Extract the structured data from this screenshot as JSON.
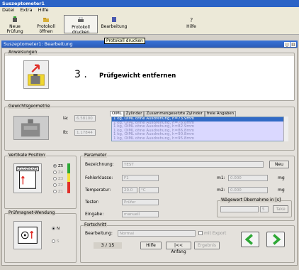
{
  "window": {
    "title": "Suszeptometer1"
  },
  "menu": {
    "items": [
      "Datei",
      "Extra",
      "Hilfe"
    ]
  },
  "toolbar": {
    "items": [
      "Neue Prüfung",
      "Protokoll öffnen",
      "Protokoll drucken",
      "Bearbeitung",
      "Hilfe"
    ],
    "tooltip": "Protokoll drucken"
  },
  "subwindow": {
    "title": "Suszeptometer1: Bearbeitung"
  },
  "instructions": {
    "legend": "Anweisungen",
    "step": "3 .",
    "text": "Prüfgewicht entfernen"
  },
  "geometry": {
    "legend": "Gewichtsgeometrie",
    "ia_label": "Ia:",
    "ia_value": "6.58100",
    "ib_label": "Ib:",
    "ib_value": "1.17844",
    "tabs": [
      "OIML",
      "Zylinder",
      "Zusammengesetzte Zylinder",
      "freie Angaben"
    ],
    "list": [
      "1 kg, OIML ohne Ausdrehung, h=73.9mm",
      "1 kg, OIML ohne Ausdrehung, h=78.8mm",
      "1 kg, OIML ohne Ausdrehung, h=82.9mm",
      "1 kg, OIML ohne Ausdrehung, h=86.8mm",
      "1 kg, OIML ohne Ausdrehung, h=90.8mm",
      "1 kg, OIML ohne Ausdrehung, h=95.8mm"
    ]
  },
  "position": {
    "legend": "Vertikale Position",
    "options": [
      "Z5",
      "Z4",
      "Z3",
      "Z2",
      "Z1"
    ],
    "selected": "Z5",
    "sensor_label": "Z1Z2Z3Z4Z5"
  },
  "magnet": {
    "legend": "Prüfmagnet-Wendung",
    "options": [
      "N",
      "S"
    ],
    "selected": "N"
  },
  "params": {
    "legend": "Parameter",
    "bez_label": "Bezeichnung:",
    "bez_value": "TEST",
    "fehler_label": "Fehlerklasse:",
    "fehler_value": "F1",
    "temp_label": "Temperatur:",
    "temp_value": "20.0",
    "temp_unit": "°C",
    "tester_label": "Tester:",
    "tester_value": "Prüfer",
    "eingabe_label": "Eingabe:",
    "eingabe_value": "manuell",
    "neu_label": "Neu",
    "m1_label": "m1:",
    "m1_value": "0.000",
    "m1_unit": "mg",
    "m2_label": "m2:",
    "m2_value": "0.000",
    "m2_unit": "mg",
    "weigh_legend": "Wägewert Übernahme in [s]",
    "weigh_value": "5",
    "take_label": "Take"
  },
  "progress": {
    "legend": "Fortschritt",
    "bearb_label": "Bearbeitung:",
    "bearb_value": "Normal",
    "export_label": "mit Export",
    "counter": "3 / 15",
    "hilfe_label": "Hilfe",
    "anfang_label": "|<< Anfang",
    "ergebnis_label": "Ergebnis"
  },
  "colors": {
    "titlebar": "#2b63c6",
    "green_arrow": "#2ea836",
    "yellow": "#f4e03a",
    "red": "#e0302a"
  }
}
